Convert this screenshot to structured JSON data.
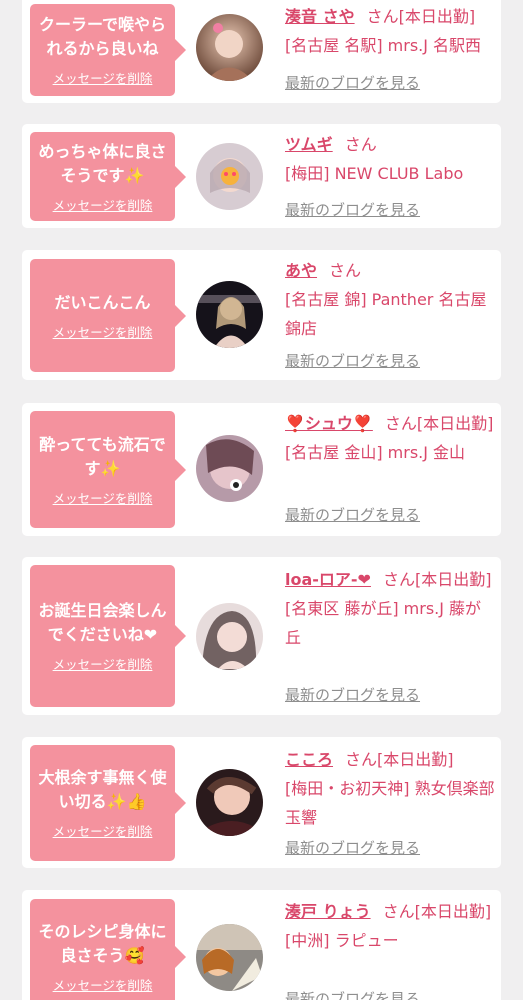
{
  "entries": [
    {
      "message": "クーラーで喉やられるから良いね",
      "delete_label": "メッセージを削除",
      "name": "湊音 さや",
      "honorific": "さん",
      "tag": "[本日出勤]",
      "shop": "[名古屋 名駅] mrs.J 名駅西",
      "blog_label": "最新のブログを見る"
    },
    {
      "message": "めっちゃ体に良さそうです✨",
      "delete_label": "メッセージを削除",
      "name": "ツムギ",
      "honorific": "さん",
      "tag": "",
      "shop": "[梅田] NEW CLUB Labo",
      "blog_label": "最新のブログを見る"
    },
    {
      "message": "だいこんこん",
      "delete_label": "メッセージを削除",
      "name": "あや",
      "honorific": "さん",
      "tag": "",
      "shop": "[名古屋 錦] Panther 名古屋錦店",
      "blog_label": "最新のブログを見る"
    },
    {
      "message": "酔ってても流石です✨",
      "delete_label": "メッセージを削除",
      "name": "❣️シュウ❣️",
      "honorific": "さん",
      "tag": "[本日出勤]",
      "shop": "[名古屋 金山] mrs.J 金山",
      "blog_label": "最新のブログを見る"
    },
    {
      "message": "お誕生日会楽しんでくださいね❤",
      "delete_label": "メッセージを削除",
      "name": "loa-ロア-❤",
      "honorific": "さん",
      "tag": "[本日出勤]",
      "shop": "[名東区 藤が丘] mrs.J 藤が丘",
      "blog_label": "最新のブログを見る"
    },
    {
      "message": "大根余す事無く使い切る✨👍",
      "delete_label": "メッセージを削除",
      "name": "こころ",
      "honorific": "さん",
      "tag": "[本日出勤]",
      "shop": "[梅田・お初天神] 熟女倶楽部 玉響",
      "blog_label": "最新のブログを見る"
    },
    {
      "message": "そのレシピ身体に良さそう🥰",
      "delete_label": "メッセージを削除",
      "name": "湊戸 りょう",
      "honorific": "さん",
      "tag": "[本日出勤]",
      "shop": "[中洲] ラピュー",
      "blog_label": "最新のブログを見る"
    }
  ],
  "colors": {
    "accent_pink": "#d9476a",
    "bubble_pink": "#f4929e",
    "link_gray": "#8e8e8e"
  },
  "icons": {
    "avatar": "profile-photo"
  }
}
